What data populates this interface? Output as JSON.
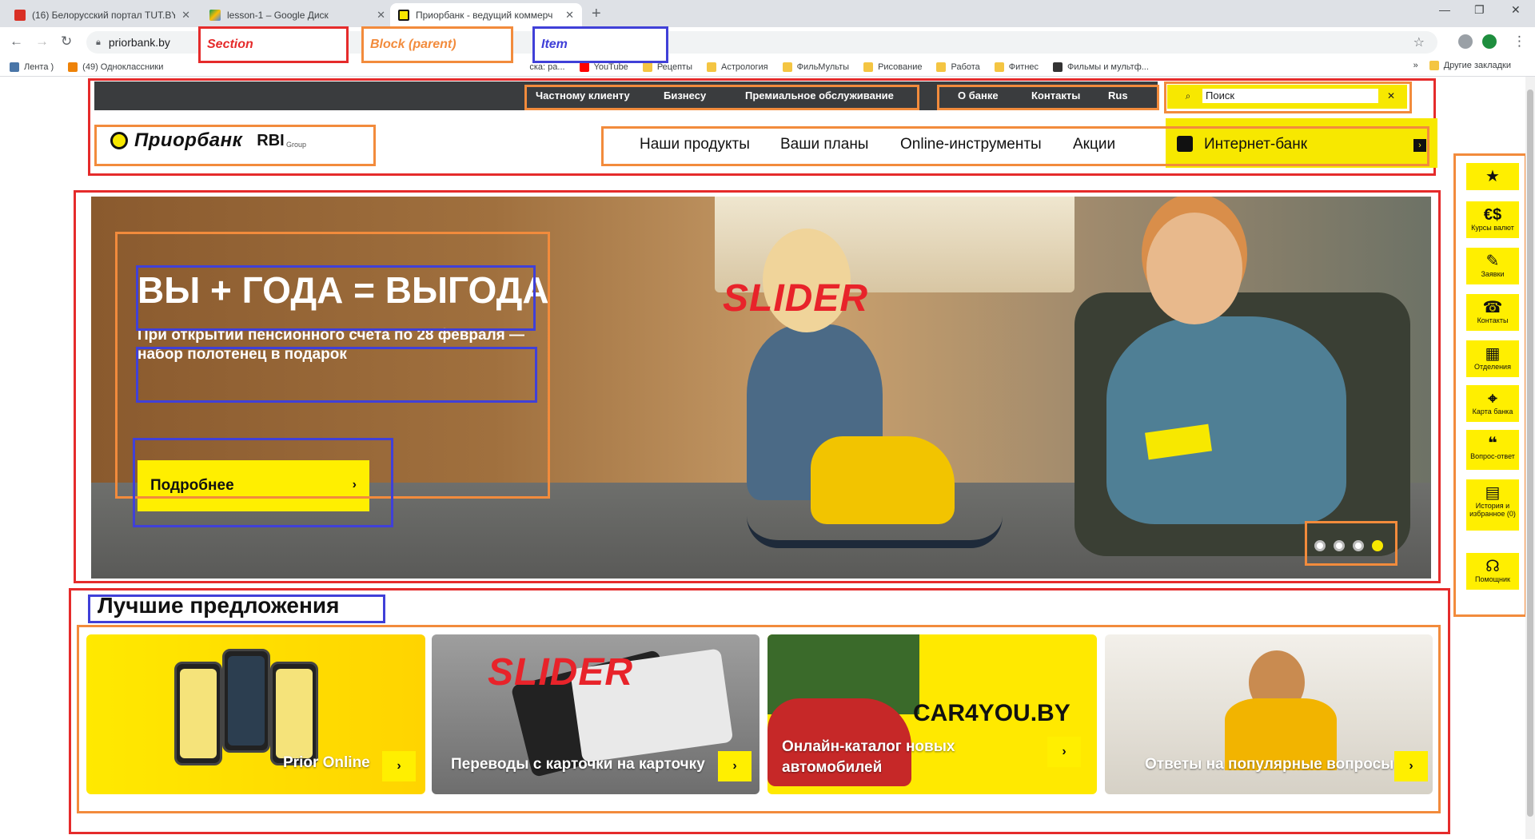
{
  "browser": {
    "tabs": [
      {
        "title": "(16) Белорусский портал TUT.BY",
        "active": false
      },
      {
        "title": "lesson-1 – Google Диск",
        "active": false
      },
      {
        "title": "Приорбанк - ведущий коммерч",
        "active": true
      }
    ],
    "url": "priorbank.by",
    "bookmarks": [
      "Лента )",
      "(49) Одноклассники",
      "ска: ра...",
      "YouTube",
      "Рецепты",
      "Астрология",
      "ФильМульты",
      "Рисование",
      "Работа",
      "Фитнес",
      "Фильмы и мультф..."
    ],
    "bookmarks_more": "»",
    "other_bookmarks": "Другие закладки"
  },
  "legend": {
    "section": "Section",
    "block": "Block (parent)",
    "item": "Item",
    "colors": {
      "section": "#e52b2b",
      "block": "#f28b3c",
      "item": "#4040d8"
    }
  },
  "topbar": {
    "links": [
      "Частному клиенту",
      "Бизнесу",
      "Премиальное обслуживание"
    ],
    "links_right": [
      "О банке",
      "Контакты",
      "Rus"
    ],
    "search_placeholder": "Поиск"
  },
  "brand": {
    "name": "Приорбанк",
    "partner": "RBI",
    "partner_sub": "Group",
    "color": "#f7e800"
  },
  "nav": {
    "items": [
      "Наши продукты",
      "Ваши планы",
      "Online-инструменты",
      "Акции"
    ],
    "ibank": "Интернет-банк"
  },
  "hero": {
    "title": "ВЫ + ГОДА = ВЫГОДА",
    "subtitle": "При открытии пенсионного счета по 28 февраля — набор полотенец в подарок",
    "button": "Подробнее",
    "watermark": "SLIDER",
    "slides": 4,
    "active_slide": 4
  },
  "best": {
    "title": "Лучшие предложения",
    "watermark": "SLIDER",
    "cards": [
      {
        "label": "Prior Online"
      },
      {
        "label": "Переводы с карточки на карточку"
      },
      {
        "label": "Онлайн-каталог новых автомобилей",
        "brand": "CAR4YOU.BY"
      },
      {
        "label": "Ответы на популярные вопросы"
      }
    ]
  },
  "quick": [
    {
      "icon": "★",
      "label": ""
    },
    {
      "icon": "€$",
      "label": "Курсы валют"
    },
    {
      "icon": "✎",
      "label": "Заявки"
    },
    {
      "icon": "☎",
      "label": "Контакты"
    },
    {
      "icon": "▦",
      "label": "Отделения"
    },
    {
      "icon": "⌖",
      "label": "Карта банка"
    },
    {
      "icon": "❝",
      "label": "Вопрос-ответ"
    },
    {
      "icon": "▤",
      "label": "История и избранное (0)"
    },
    {
      "icon": "☊",
      "label": "Помощник"
    }
  ]
}
